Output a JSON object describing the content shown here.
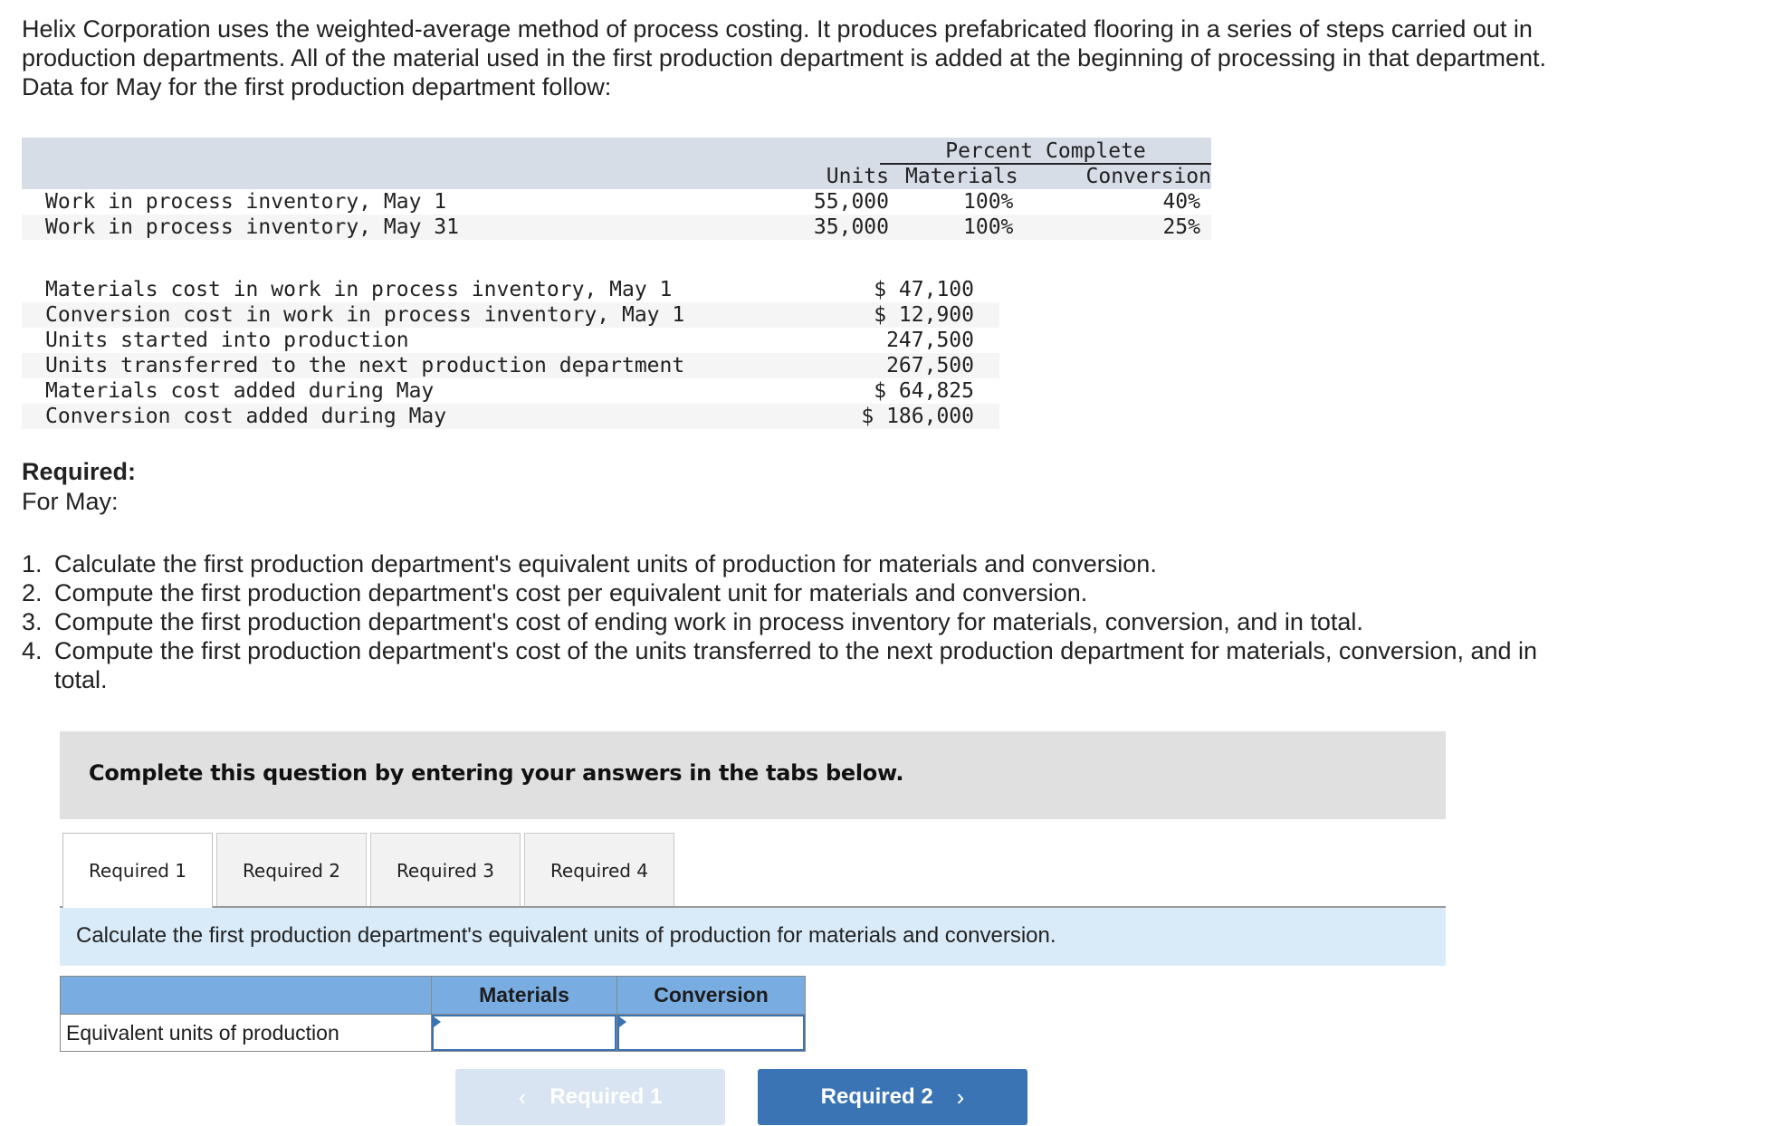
{
  "intro": "Helix Corporation uses the weighted-average method of process costing. It produces prefabricated flooring in a series of steps carried out in production departments. All of the material used in the first production department is added at the beginning of processing in that department. Data for May for the first production department follow:",
  "inventory_table": {
    "group_header": "Percent Complete",
    "headers": {
      "units": "Units",
      "materials": "Materials",
      "conversion": "Conversion"
    },
    "rows": [
      {
        "label": "Work in process inventory, May 1",
        "units": "55,000",
        "materials": "100%",
        "conversion": "40%"
      },
      {
        "label": "Work in process inventory, May 31",
        "units": "35,000",
        "materials": "100%",
        "conversion": "25%"
      }
    ]
  },
  "cost_table": {
    "rows": [
      {
        "label": "Materials cost in work in process inventory, May 1",
        "value": "$ 47,100"
      },
      {
        "label": "Conversion cost in work in process inventory, May 1",
        "value": "$ 12,900"
      },
      {
        "label": "Units started into production",
        "value": "247,500"
      },
      {
        "label": "Units transferred to the next production department",
        "value": "267,500"
      },
      {
        "label": "Materials cost added during May",
        "value": "$ 64,825"
      },
      {
        "label": "Conversion cost added during May",
        "value": "$ 186,000"
      }
    ]
  },
  "required": {
    "title": "Required:",
    "subtitle": "For May:",
    "items": [
      {
        "num": "1.",
        "text": "Calculate the first production department's equivalent units of production for materials and conversion."
      },
      {
        "num": "2.",
        "text": "Compute the first production department's cost per equivalent unit for materials and conversion."
      },
      {
        "num": "3.",
        "text": "Compute the first production department's cost of ending work in process inventory for materials, conversion, and in total."
      },
      {
        "num": "4.",
        "text": "Compute the first production department's cost of the units transferred to the next production department for materials, conversion, and in total."
      }
    ]
  },
  "banner": "Complete this question by entering your answers in the tabs below.",
  "tabs": [
    {
      "label": "Required 1",
      "active": true
    },
    {
      "label": "Required 2",
      "active": false
    },
    {
      "label": "Required 3",
      "active": false
    },
    {
      "label": "Required 4",
      "active": false
    }
  ],
  "instruction": "Calculate the first production department's equivalent units of production for materials and conversion.",
  "answer_table": {
    "headers": [
      "",
      "Materials",
      "Conversion"
    ],
    "row_label": "Equivalent units of production",
    "materials_value": "",
    "conversion_value": ""
  },
  "nav": {
    "prev_label": "Required 1",
    "prev_icon": "chevron-left-icon",
    "next_label": "Required 2",
    "next_icon": "chevron-right-icon"
  },
  "colors": {
    "table_header_bg": "#d7dde7",
    "banner_bg": "#e0e0e0",
    "instruction_bg": "#d9ebf9",
    "answer_header_bg": "#79ade2",
    "next_button_bg": "#3a74b4",
    "prev_button_bg": "#d8e4f1"
  }
}
